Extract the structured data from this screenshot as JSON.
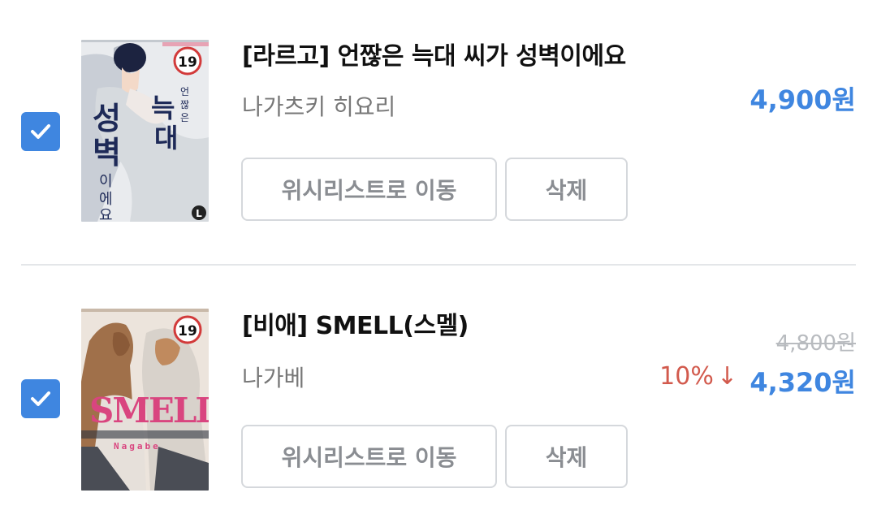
{
  "cart": {
    "items": [
      {
        "checked": true,
        "title": "[라르고] 언짢은 늑대 씨가 성벽이에요",
        "author": "나가츠키 히요리",
        "price": "4,900원",
        "cover": {
          "age_badge": "19",
          "text_large_1": "성",
          "text_large_2": "벽",
          "text_small_1": "이",
          "text_small_2": "에",
          "text_small_3": "요",
          "text_side_1": "늑",
          "text_side_2": "대",
          "text_vert_1": "언",
          "text_vert_2": "짢",
          "text_vert_3": "은",
          "publisher_mark": "L"
        },
        "buttons": {
          "move_label": "위시리스트로 이동",
          "delete_label": "삭제"
        }
      },
      {
        "checked": true,
        "title": "[비애] SMELL(스멜)",
        "author": "나가베",
        "original_price": "4,800원",
        "discount": "10%",
        "discount_arrow": "↓",
        "price": "4,320원",
        "cover": {
          "age_badge": "19",
          "title_art": "SMELL",
          "subtitle_art": "Nagabe"
        },
        "buttons": {
          "move_label": "위시리스트로 이동",
          "delete_label": "삭제"
        }
      }
    ]
  },
  "colors": {
    "accent": "#3f86e0",
    "discount": "#d25a4d",
    "muted": "#777777",
    "button_text": "#8a8d92",
    "border": "#d5d8dc"
  }
}
